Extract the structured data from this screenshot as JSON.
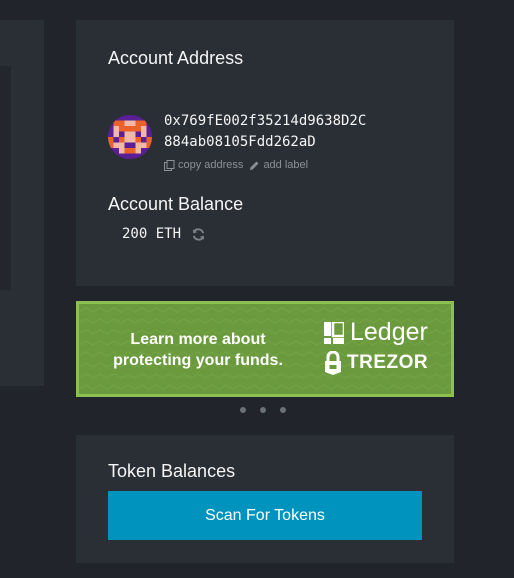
{
  "account": {
    "address_title": "Account Address",
    "address_line1": "0x769fE002f35214d9638D2C",
    "address_line2": "884ab08105Fdd262aD",
    "copy_label": "copy address",
    "add_label": "add label",
    "balance_title": "Account Balance",
    "balance_value": "200 ETH"
  },
  "banner": {
    "text": "Learn more about protecting your funds.",
    "ledger": "Ledger",
    "trezor": "TREZOR",
    "background": "#6a9a3d",
    "border": "#8cc152"
  },
  "carousel": {
    "count": 3
  },
  "tokens": {
    "title": "Token Balances",
    "scan_label": "Scan For Tokens",
    "button_color": "#0093bd"
  },
  "icons": [
    "identicon-avatar",
    "copy-icon",
    "pencil-icon",
    "refresh-icon",
    "ledger-logo-icon",
    "trezor-lock-icon"
  ]
}
